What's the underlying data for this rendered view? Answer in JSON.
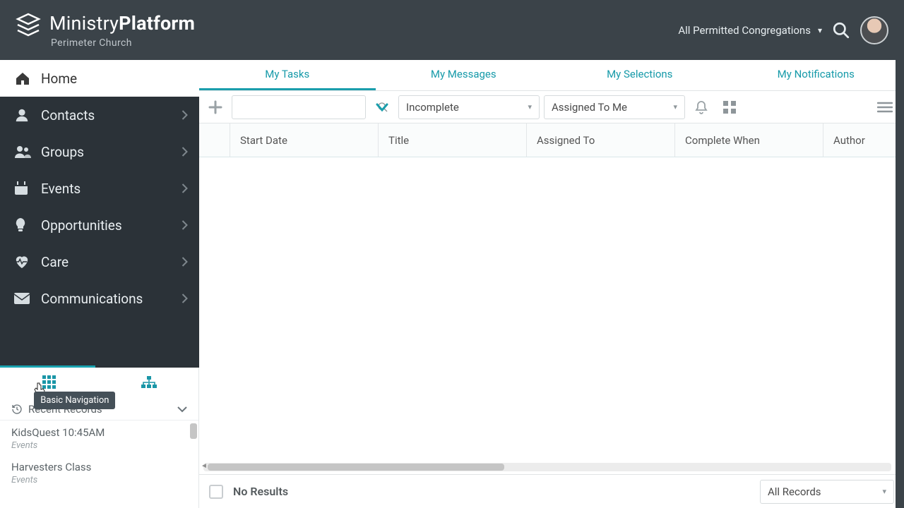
{
  "brand": {
    "title_a": "Ministry",
    "title_b": "Platform",
    "subtitle": "Perimeter Church"
  },
  "header": {
    "scope": "All Permitted Congregations"
  },
  "nav": {
    "home": "Home",
    "items": [
      {
        "label": "Contacts"
      },
      {
        "label": "Groups"
      },
      {
        "label": "Events"
      },
      {
        "label": "Opportunities"
      },
      {
        "label": "Care"
      },
      {
        "label": "Communications"
      }
    ]
  },
  "navmode_tooltip": "Basic Navigation",
  "recent": {
    "header": "Recent Records",
    "items": [
      {
        "title": "KidsQuest 10:45AM",
        "sub": "Events"
      },
      {
        "title": "Harvesters Class",
        "sub": "Events"
      }
    ]
  },
  "tabs": [
    {
      "label": "My Tasks",
      "active": true
    },
    {
      "label": "My Messages"
    },
    {
      "label": "My Selections"
    },
    {
      "label": "My Notifications"
    }
  ],
  "toolbar": {
    "search_value": "",
    "status_value": "Incomplete",
    "assigned_value": "Assigned To Me"
  },
  "columns": [
    "Start Date",
    "Title",
    "Assigned To",
    "Complete When",
    "Author"
  ],
  "footer": {
    "result_text": "No Results",
    "records_filter": "All Records"
  }
}
